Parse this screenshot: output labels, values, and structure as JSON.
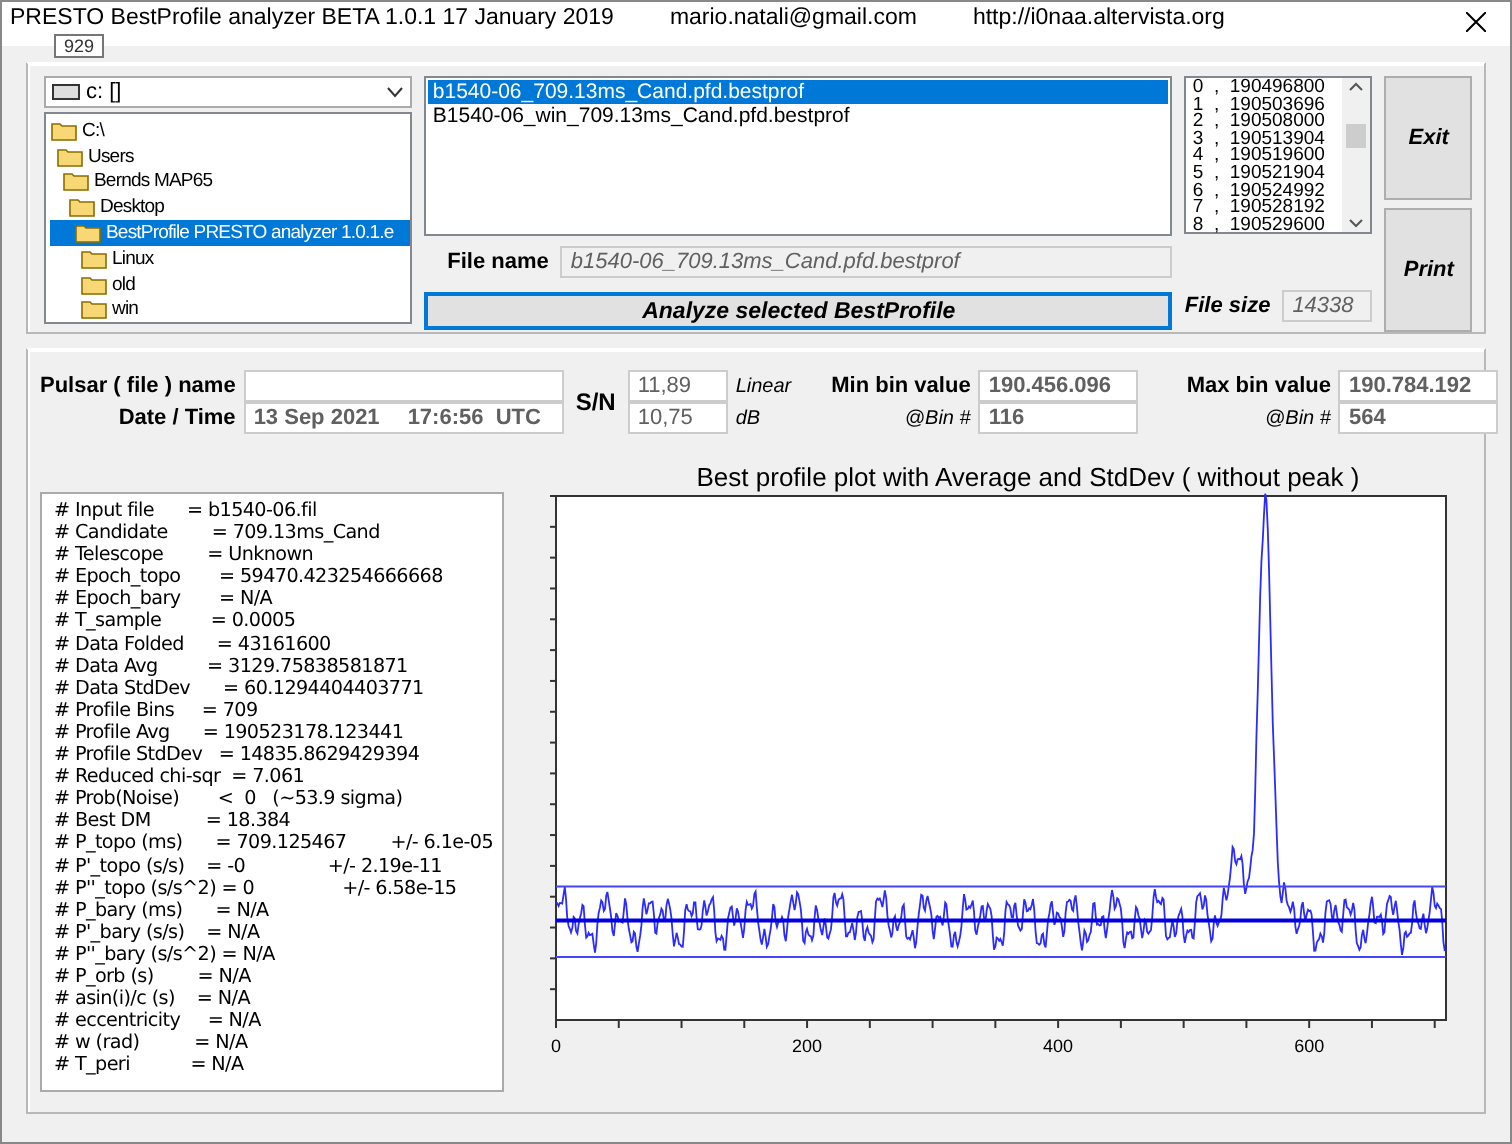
{
  "window": {
    "title": "PRESTO BestProfile analyzer BETA 1.0.1   17 January 2019",
    "email": "mario.natali@gmail.com",
    "url": "http://i0naa.altervista.org",
    "tooltip": "929"
  },
  "drive": {
    "value": "c: []"
  },
  "folders": [
    {
      "label": "C:\\",
      "selected": false,
      "children": [
        {
          "label": "Users",
          "selected": false,
          "children": [
            {
              "label": "Bernds MAP65",
              "selected": false,
              "children": [
                {
                  "label": "Desktop",
                  "selected": false,
                  "children": [
                    {
                      "label": "BestProfile PRESTO analyzer 1.0.1.e",
                      "selected": true,
                      "children": [
                        {
                          "label": "Linux",
                          "selected": false
                        },
                        {
                          "label": "old",
                          "selected": false
                        },
                        {
                          "label": "win",
                          "selected": false
                        }
                      ]
                    }
                  ]
                }
              ]
            }
          ]
        }
      ]
    }
  ],
  "files": [
    {
      "name": "b1540-06_709.13ms_Cand.pfd.bestprof",
      "selected": true
    },
    {
      "name": "B1540-06_win_709.13ms_Cand.pfd.bestprof",
      "selected": false
    }
  ],
  "file_name": {
    "label": "File name",
    "value": "b1540-06_709.13ms_Cand.pfd.bestprof"
  },
  "analyze_button": "Analyze selected BestProfile",
  "bins": [
    {
      "index": "0",
      "value": "190496800"
    },
    {
      "index": "1",
      "value": "190503696"
    },
    {
      "index": "2",
      "value": "190508000"
    },
    {
      "index": "3",
      "value": "190513904"
    },
    {
      "index": "4",
      "value": "190519600"
    },
    {
      "index": "5",
      "value": "190521904"
    },
    {
      "index": "6",
      "value": "190524992"
    },
    {
      "index": "7",
      "value": "190528192"
    },
    {
      "index": "8",
      "value": "190529600"
    }
  ],
  "bin_separator": ",",
  "file_size": {
    "label": "File size",
    "value": "14338"
  },
  "buttons": [
    "Exit",
    "Print"
  ],
  "pulsar": {
    "name_label": "Pulsar ( file ) name",
    "date_label": "Date / Time",
    "date": "13 Sep 2021",
    "time": "17:6:56  UTC"
  },
  "sn": {
    "label": "S/N",
    "linear": "11,89",
    "linear_unit": "Linear",
    "db": "10,75",
    "db_unit": "dB"
  },
  "min_bin": {
    "label": "Min bin value",
    "value": "190.456.096",
    "bin_label": "@Bin #",
    "bin": "116"
  },
  "max_bin": {
    "label": "Max bin value",
    "value": "190.784.192",
    "bin_label": "@Bin #",
    "bin": "564"
  },
  "info_lines": [
    "# Input file      = b1540-06.fil",
    "# Candidate        = 709.13ms_Cand",
    "# Telescope        = Unknown",
    "# Epoch_topo       = 59470.423254666668",
    "# Epoch_bary       = N/A",
    "# T_sample         = 0.0005",
    "# Data Folded      = 43161600",
    "# Data Avg         = 3129.75838581871",
    "# Data StdDev      = 60.1294404403771",
    "# Profile Bins     = 709",
    "# Profile Avg      = 190523178.123441",
    "# Profile StdDev   = 14835.8629429394",
    "# Reduced chi-sqr  = 7.061",
    "# Prob(Noise)       <  0   (~53.9 sigma)",
    "# Best DM          = 18.384",
    "# P_topo (ms)      = 709.125467        +/- 6.1e-05",
    "# P'_topo (s/s)    = -0               +/- 2.19e-11",
    "# P''_topo (s/s^2) = 0                +/- 6.58e-15",
    "# P_bary (ms)      = N/A",
    "# P'_bary (s/s)    = N/A",
    "# P''_bary (s/s^2) = N/A",
    "# P_orb (s)        = N/A",
    "# asin(i)/c (s)    = N/A",
    "# eccentricity     = N/A",
    "# w (rad)          = N/A",
    "# T_peri           = N/A"
  ],
  "plot": {
    "title": "Best profile plot with  Average and StdDev ( without peak )",
    "x_tick_labels": [
      "0",
      "200",
      "400",
      "600"
    ]
  }
}
